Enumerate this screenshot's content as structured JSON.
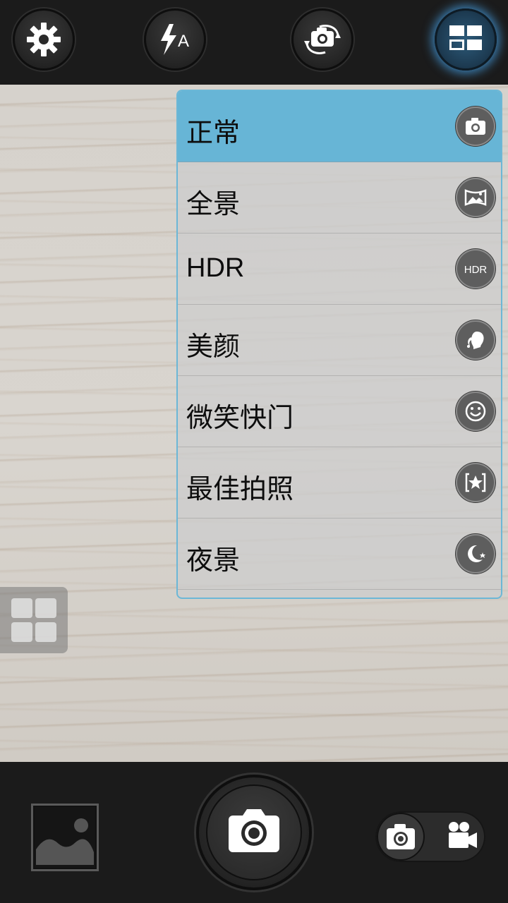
{
  "topbar": {
    "settings_icon": "gear-icon",
    "flash_icon": "flash-auto-icon",
    "flash_label": "A",
    "switch_camera_icon": "camera-switch-icon",
    "mode_icon": "grid-mode-icon"
  },
  "menu": {
    "items": [
      {
        "label": "正常",
        "icon": "camera-icon",
        "selected": true
      },
      {
        "label": "全景",
        "icon": "panorama-icon",
        "selected": false
      },
      {
        "label": "HDR",
        "icon": "hdr-icon",
        "icon_text": "HDR",
        "selected": false
      },
      {
        "label": "美颜",
        "icon": "beauty-icon",
        "selected": false
      },
      {
        "label": "微笑快门",
        "icon": "smile-icon",
        "selected": false
      },
      {
        "label": "最佳拍照",
        "icon": "best-shot-icon",
        "selected": false
      },
      {
        "label": "夜景",
        "icon": "night-icon",
        "selected": false
      }
    ]
  },
  "bottombar": {
    "gallery_icon": "gallery-thumbnail-icon",
    "shutter_icon": "shutter-camera-icon",
    "mode_switch": {
      "photo_icon": "photo-mode-icon",
      "video_icon": "video-mode-icon",
      "active": "photo"
    }
  },
  "colors": {
    "selected": "#67b5d6",
    "accent_glow": "#46a0e6",
    "bar": "#1b1b1b"
  }
}
